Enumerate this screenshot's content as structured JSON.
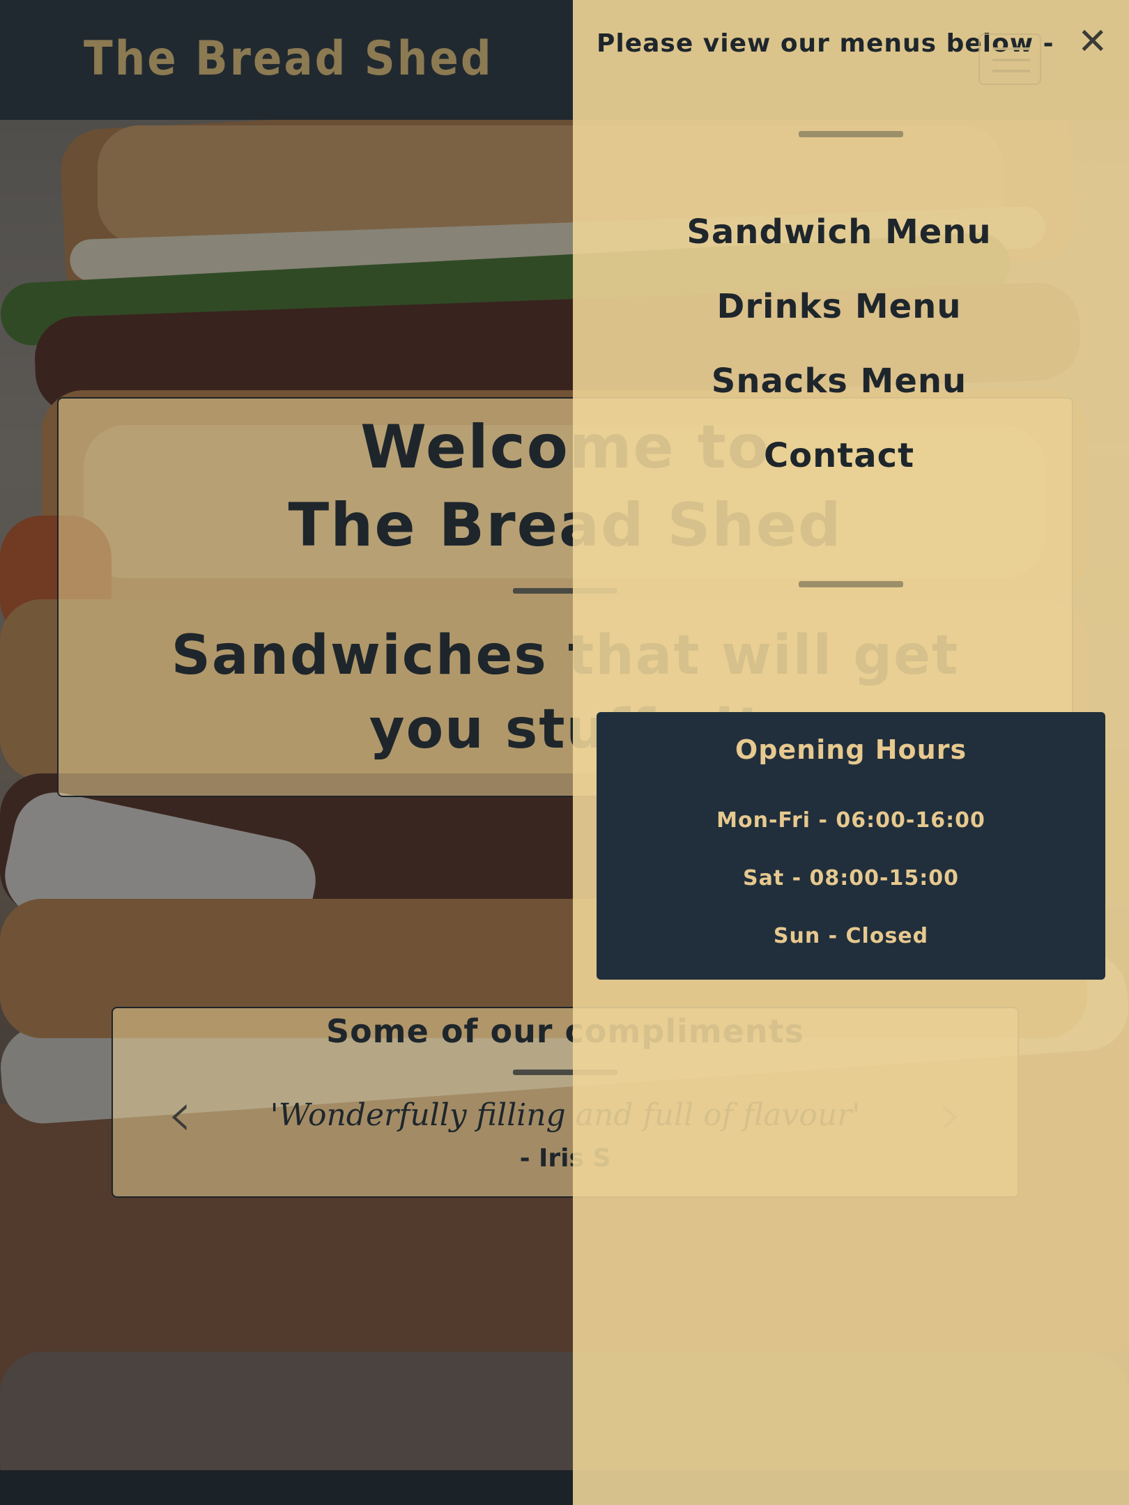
{
  "header": {
    "brand": "The Bread Shed"
  },
  "hero": {
    "title_line1": "Welcome to",
    "title_line2": "The Bread Shed",
    "tagline": "Sandwiches that will get you stuffed!"
  },
  "compliments": {
    "title": "Some of our compliments",
    "quote": "'Wonderfully filling and full of flavour'",
    "author": "- Iris S",
    "prev_icon": "chevron-left-icon",
    "next_icon": "chevron-right-icon"
  },
  "overlay": {
    "message": "Please view our menus below -",
    "menu_items": [
      {
        "label": "Sandwich Menu"
      },
      {
        "label": "Drinks Menu"
      },
      {
        "label": "Snacks Menu"
      },
      {
        "label": "Contact"
      }
    ],
    "close_icon": "close-icon",
    "toggle_icon": "hamburger-icon"
  },
  "hours": {
    "title": "Opening Hours",
    "lines": [
      "Mon-Fri - 06:00-16:00",
      "Sat - 08:00-15:00",
      "Sun - Closed"
    ]
  },
  "colors": {
    "header_bg": "#212930",
    "accent_gold": "#e7c98f",
    "panel_bg": "#f0d698",
    "text_dark": "#1e262c"
  }
}
